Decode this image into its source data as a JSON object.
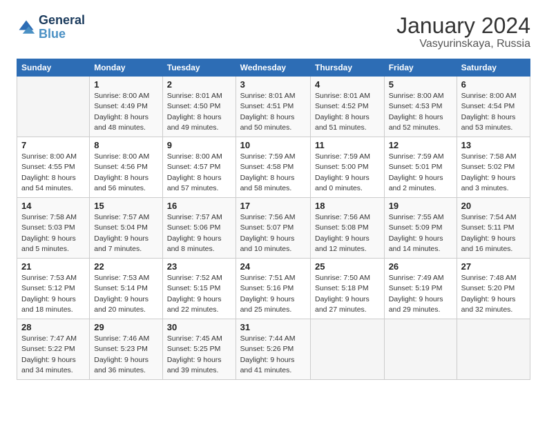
{
  "header": {
    "logo_line1": "General",
    "logo_line2": "Blue",
    "month": "January 2024",
    "location": "Vasyurinskaya, Russia"
  },
  "weekdays": [
    "Sunday",
    "Monday",
    "Tuesday",
    "Wednesday",
    "Thursday",
    "Friday",
    "Saturday"
  ],
  "weeks": [
    [
      {
        "day": "",
        "sunrise": "",
        "sunset": "",
        "daylight": ""
      },
      {
        "day": "1",
        "sunrise": "Sunrise: 8:00 AM",
        "sunset": "Sunset: 4:49 PM",
        "daylight": "Daylight: 8 hours and 48 minutes."
      },
      {
        "day": "2",
        "sunrise": "Sunrise: 8:01 AM",
        "sunset": "Sunset: 4:50 PM",
        "daylight": "Daylight: 8 hours and 49 minutes."
      },
      {
        "day": "3",
        "sunrise": "Sunrise: 8:01 AM",
        "sunset": "Sunset: 4:51 PM",
        "daylight": "Daylight: 8 hours and 50 minutes."
      },
      {
        "day": "4",
        "sunrise": "Sunrise: 8:01 AM",
        "sunset": "Sunset: 4:52 PM",
        "daylight": "Daylight: 8 hours and 51 minutes."
      },
      {
        "day": "5",
        "sunrise": "Sunrise: 8:00 AM",
        "sunset": "Sunset: 4:53 PM",
        "daylight": "Daylight: 8 hours and 52 minutes."
      },
      {
        "day": "6",
        "sunrise": "Sunrise: 8:00 AM",
        "sunset": "Sunset: 4:54 PM",
        "daylight": "Daylight: 8 hours and 53 minutes."
      }
    ],
    [
      {
        "day": "7",
        "sunrise": "Sunrise: 8:00 AM",
        "sunset": "Sunset: 4:55 PM",
        "daylight": "Daylight: 8 hours and 54 minutes."
      },
      {
        "day": "8",
        "sunrise": "Sunrise: 8:00 AM",
        "sunset": "Sunset: 4:56 PM",
        "daylight": "Daylight: 8 hours and 56 minutes."
      },
      {
        "day": "9",
        "sunrise": "Sunrise: 8:00 AM",
        "sunset": "Sunset: 4:57 PM",
        "daylight": "Daylight: 8 hours and 57 minutes."
      },
      {
        "day": "10",
        "sunrise": "Sunrise: 7:59 AM",
        "sunset": "Sunset: 4:58 PM",
        "daylight": "Daylight: 8 hours and 58 minutes."
      },
      {
        "day": "11",
        "sunrise": "Sunrise: 7:59 AM",
        "sunset": "Sunset: 5:00 PM",
        "daylight": "Daylight: 9 hours and 0 minutes."
      },
      {
        "day": "12",
        "sunrise": "Sunrise: 7:59 AM",
        "sunset": "Sunset: 5:01 PM",
        "daylight": "Daylight: 9 hours and 2 minutes."
      },
      {
        "day": "13",
        "sunrise": "Sunrise: 7:58 AM",
        "sunset": "Sunset: 5:02 PM",
        "daylight": "Daylight: 9 hours and 3 minutes."
      }
    ],
    [
      {
        "day": "14",
        "sunrise": "Sunrise: 7:58 AM",
        "sunset": "Sunset: 5:03 PM",
        "daylight": "Daylight: 9 hours and 5 minutes."
      },
      {
        "day": "15",
        "sunrise": "Sunrise: 7:57 AM",
        "sunset": "Sunset: 5:04 PM",
        "daylight": "Daylight: 9 hours and 7 minutes."
      },
      {
        "day": "16",
        "sunrise": "Sunrise: 7:57 AM",
        "sunset": "Sunset: 5:06 PM",
        "daylight": "Daylight: 9 hours and 8 minutes."
      },
      {
        "day": "17",
        "sunrise": "Sunrise: 7:56 AM",
        "sunset": "Sunset: 5:07 PM",
        "daylight": "Daylight: 9 hours and 10 minutes."
      },
      {
        "day": "18",
        "sunrise": "Sunrise: 7:56 AM",
        "sunset": "Sunset: 5:08 PM",
        "daylight": "Daylight: 9 hours and 12 minutes."
      },
      {
        "day": "19",
        "sunrise": "Sunrise: 7:55 AM",
        "sunset": "Sunset: 5:09 PM",
        "daylight": "Daylight: 9 hours and 14 minutes."
      },
      {
        "day": "20",
        "sunrise": "Sunrise: 7:54 AM",
        "sunset": "Sunset: 5:11 PM",
        "daylight": "Daylight: 9 hours and 16 minutes."
      }
    ],
    [
      {
        "day": "21",
        "sunrise": "Sunrise: 7:53 AM",
        "sunset": "Sunset: 5:12 PM",
        "daylight": "Daylight: 9 hours and 18 minutes."
      },
      {
        "day": "22",
        "sunrise": "Sunrise: 7:53 AM",
        "sunset": "Sunset: 5:14 PM",
        "daylight": "Daylight: 9 hours and 20 minutes."
      },
      {
        "day": "23",
        "sunrise": "Sunrise: 7:52 AM",
        "sunset": "Sunset: 5:15 PM",
        "daylight": "Daylight: 9 hours and 22 minutes."
      },
      {
        "day": "24",
        "sunrise": "Sunrise: 7:51 AM",
        "sunset": "Sunset: 5:16 PM",
        "daylight": "Daylight: 9 hours and 25 minutes."
      },
      {
        "day": "25",
        "sunrise": "Sunrise: 7:50 AM",
        "sunset": "Sunset: 5:18 PM",
        "daylight": "Daylight: 9 hours and 27 minutes."
      },
      {
        "day": "26",
        "sunrise": "Sunrise: 7:49 AM",
        "sunset": "Sunset: 5:19 PM",
        "daylight": "Daylight: 9 hours and 29 minutes."
      },
      {
        "day": "27",
        "sunrise": "Sunrise: 7:48 AM",
        "sunset": "Sunset: 5:20 PM",
        "daylight": "Daylight: 9 hours and 32 minutes."
      }
    ],
    [
      {
        "day": "28",
        "sunrise": "Sunrise: 7:47 AM",
        "sunset": "Sunset: 5:22 PM",
        "daylight": "Daylight: 9 hours and 34 minutes."
      },
      {
        "day": "29",
        "sunrise": "Sunrise: 7:46 AM",
        "sunset": "Sunset: 5:23 PM",
        "daylight": "Daylight: 9 hours and 36 minutes."
      },
      {
        "day": "30",
        "sunrise": "Sunrise: 7:45 AM",
        "sunset": "Sunset: 5:25 PM",
        "daylight": "Daylight: 9 hours and 39 minutes."
      },
      {
        "day": "31",
        "sunrise": "Sunrise: 7:44 AM",
        "sunset": "Sunset: 5:26 PM",
        "daylight": "Daylight: 9 hours and 41 minutes."
      },
      {
        "day": "",
        "sunrise": "",
        "sunset": "",
        "daylight": ""
      },
      {
        "day": "",
        "sunrise": "",
        "sunset": "",
        "daylight": ""
      },
      {
        "day": "",
        "sunrise": "",
        "sunset": "",
        "daylight": ""
      }
    ]
  ]
}
